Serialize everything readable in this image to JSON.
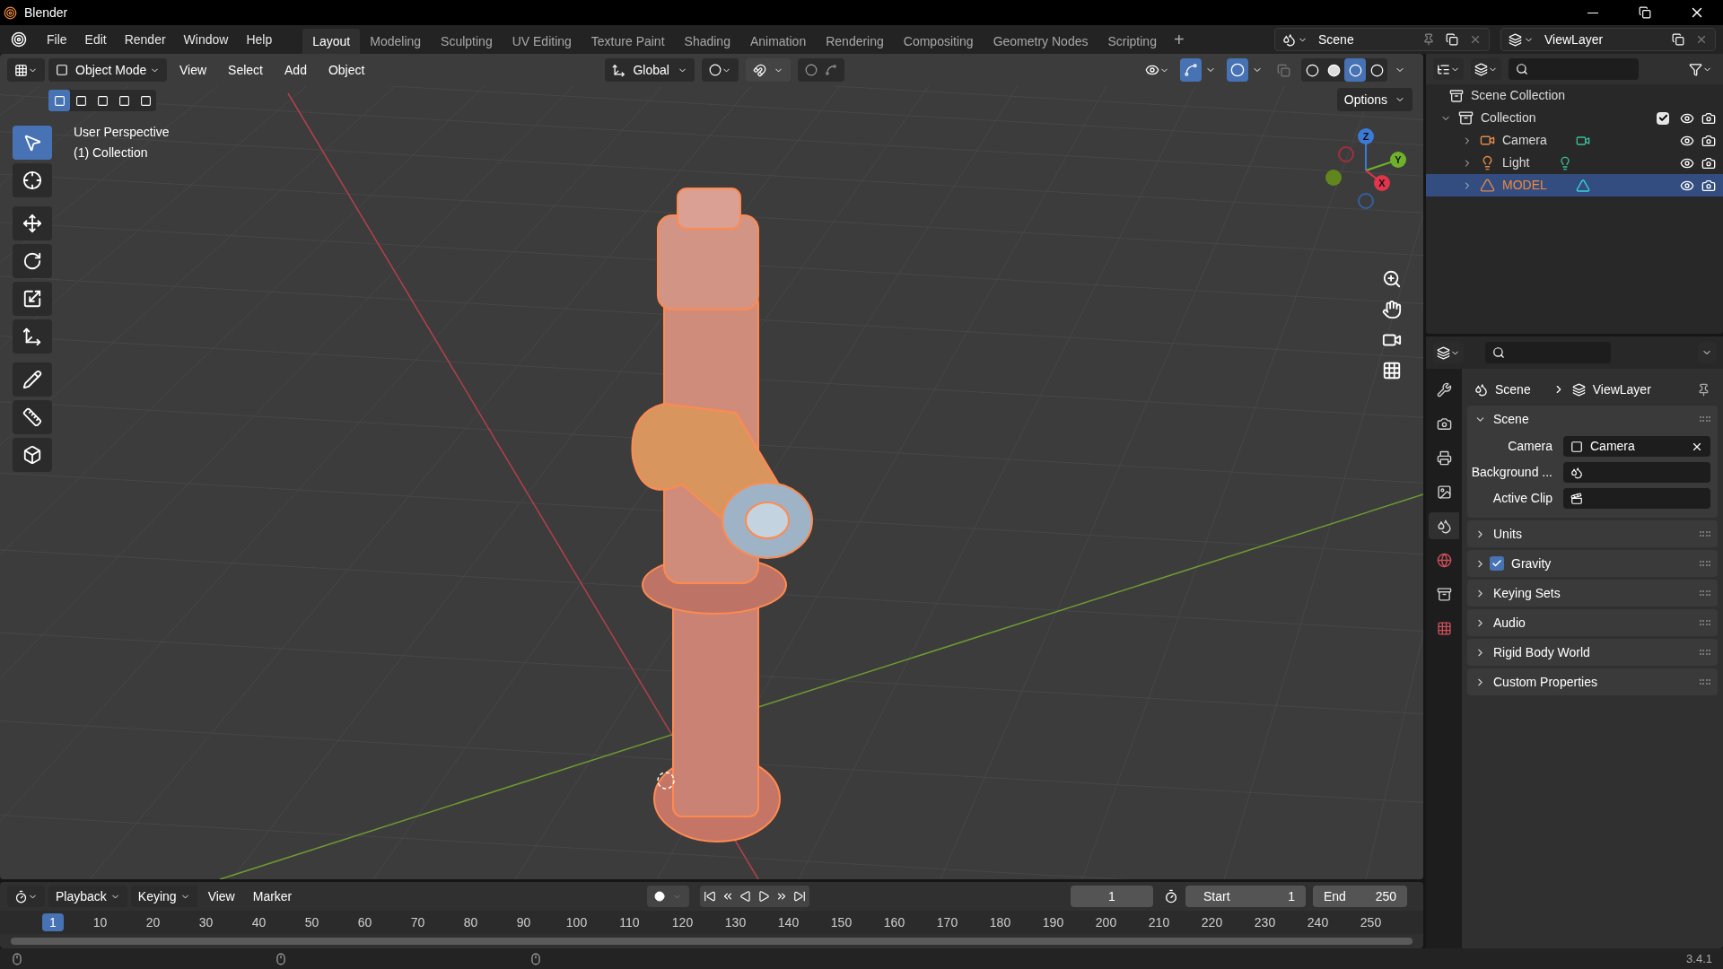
{
  "window": {
    "title": "Blender"
  },
  "menu": [
    "File",
    "Edit",
    "Render",
    "Window",
    "Help"
  ],
  "workspaces": [
    {
      "label": "Layout",
      "selected": true
    },
    {
      "label": "Modeling",
      "selected": false
    },
    {
      "label": "Sculpting",
      "selected": false
    },
    {
      "label": "UV Editing",
      "selected": false
    },
    {
      "label": "Texture Paint",
      "selected": false
    },
    {
      "label": "Shading",
      "selected": false
    },
    {
      "label": "Animation",
      "selected": false
    },
    {
      "label": "Rendering",
      "selected": false
    },
    {
      "label": "Compositing",
      "selected": false
    },
    {
      "label": "Geometry Nodes",
      "selected": false
    },
    {
      "label": "Scripting",
      "selected": false
    }
  ],
  "add_workspace": "+",
  "scene_field": "Scene",
  "view_layer_field": "ViewLayer",
  "viewport": {
    "mode": "Object Mode",
    "menus": [
      "View",
      "Select",
      "Add",
      "Object"
    ],
    "orientation": "Global",
    "options": "Options",
    "overlay_text": [
      "User Perspective",
      "(1) Collection"
    ],
    "select_modes": [
      {
        "selected": true
      },
      {
        "selected": false
      },
      {
        "selected": false
      },
      {
        "selected": false
      },
      {
        "selected": false
      }
    ],
    "shading": [
      {
        "kind": "wireframe",
        "selected": false
      },
      {
        "kind": "solid",
        "selected": false
      },
      {
        "kind": "material",
        "selected": true
      },
      {
        "kind": "rendered",
        "selected": false
      }
    ],
    "gizmo_axes": [
      "Z",
      "Y",
      "X"
    ],
    "tools": [
      {
        "kind": "select",
        "selected": true
      },
      {
        "kind": "cursor",
        "selected": false
      },
      {
        "kind": "move",
        "selected": false
      },
      {
        "kind": "rotate",
        "selected": false
      },
      {
        "kind": "scale",
        "selected": false
      },
      {
        "kind": "transform",
        "selected": false
      },
      {
        "kind": "annotate",
        "selected": false
      },
      {
        "kind": "measure",
        "selected": false
      },
      {
        "kind": "add-cube",
        "selected": false
      }
    ]
  },
  "outliner": {
    "root": "Scene Collection",
    "items": [
      {
        "label": "Collection",
        "kind": "collection",
        "expanded": true,
        "checked": true,
        "selected": false,
        "children": [
          {
            "label": "Camera",
            "kind": "camera",
            "expanded": false,
            "selected": false
          },
          {
            "label": "Light",
            "kind": "light",
            "expanded": false,
            "selected": false
          },
          {
            "label": "MODEL",
            "kind": "mesh",
            "expanded": false,
            "selected": true
          }
        ]
      }
    ]
  },
  "properties": {
    "breadcrumb": [
      "Scene",
      "ViewLayer"
    ],
    "tabs": [
      {
        "kind": "tool",
        "selected": false
      },
      {
        "kind": "render",
        "selected": false
      },
      {
        "kind": "output",
        "selected": false
      },
      {
        "kind": "view-layer",
        "selected": false
      },
      {
        "kind": "scene",
        "selected": true
      },
      {
        "kind": "world",
        "selected": false
      },
      {
        "kind": "collection",
        "selected": false
      },
      {
        "kind": "texture",
        "selected": false
      }
    ],
    "panels": [
      {
        "title": "Scene",
        "expanded": true,
        "fields": [
          {
            "label": "Camera",
            "kind": "camera",
            "value": "Camera"
          },
          {
            "label": "Background ...",
            "kind": "scene"
          },
          {
            "label": "Active Clip",
            "kind": "clip"
          }
        ]
      },
      {
        "title": "Units",
        "expanded": false
      },
      {
        "title": "Gravity",
        "expanded": false,
        "checked": true
      },
      {
        "title": "Keying Sets",
        "expanded": false
      },
      {
        "title": "Audio",
        "expanded": false
      },
      {
        "title": "Rigid Body World",
        "expanded": false
      },
      {
        "title": "Custom Properties",
        "expanded": false
      }
    ]
  },
  "timeline": {
    "menus": [
      "Playback",
      "Keying",
      "View",
      "Marker"
    ],
    "current_frame": "1",
    "start_label": "Start",
    "start": "1",
    "end_label": "End",
    "end": "250",
    "ruler_current": "1",
    "ruler": [
      "10",
      "20",
      "30",
      "40",
      "50",
      "60",
      "70",
      "80",
      "90",
      "100",
      "110",
      "120",
      "130",
      "140",
      "150",
      "160",
      "170",
      "180",
      "190",
      "200",
      "210",
      "220",
      "230",
      "240",
      "250"
    ]
  },
  "status_bar": {
    "version": "3.4.1"
  }
}
